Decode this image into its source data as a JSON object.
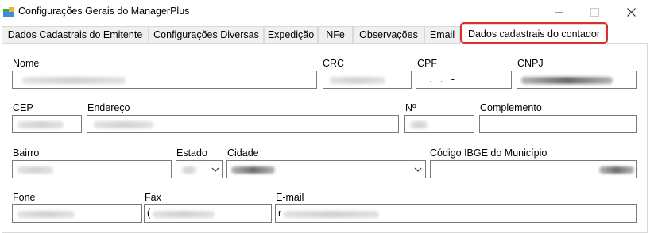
{
  "window": {
    "title": "Configurações Gerais do ManagerPlus",
    "controls": {
      "minimize_icon": "minimize-icon",
      "maximize_icon": "maximize-icon",
      "close_icon": "close-icon"
    }
  },
  "tabs": [
    {
      "label": "Dados Cadastrais do Emitente",
      "active": false
    },
    {
      "label": "Configurações Diversas",
      "active": false
    },
    {
      "label": "Expedição",
      "active": false
    },
    {
      "label": "NFe",
      "active": false
    },
    {
      "label": "Observações",
      "active": false
    },
    {
      "label": "Email",
      "active": false
    },
    {
      "label": "Dados cadastrais do contador",
      "active": true
    }
  ],
  "highlight_color": "#e02b2b",
  "form": {
    "nome": {
      "label": "Nome"
    },
    "crc": {
      "label": "CRC"
    },
    "cpf": {
      "label": "CPF",
      "mask": ".   .   -"
    },
    "cnpj": {
      "label": "CNPJ"
    },
    "cep": {
      "label": "CEP"
    },
    "endereco": {
      "label": "Endereço"
    },
    "numero": {
      "label": "Nº"
    },
    "complemento": {
      "label": "Complemento"
    },
    "bairro": {
      "label": "Bairro"
    },
    "estado": {
      "label": "Estado"
    },
    "cidade": {
      "label": "Cidade"
    },
    "codigo_ibge": {
      "label": "Código IBGE do Município"
    },
    "fone": {
      "label": "Fone"
    },
    "fax": {
      "label": "Fax",
      "prefix": "("
    },
    "email": {
      "label": "E-mail",
      "prefix": "r"
    }
  }
}
